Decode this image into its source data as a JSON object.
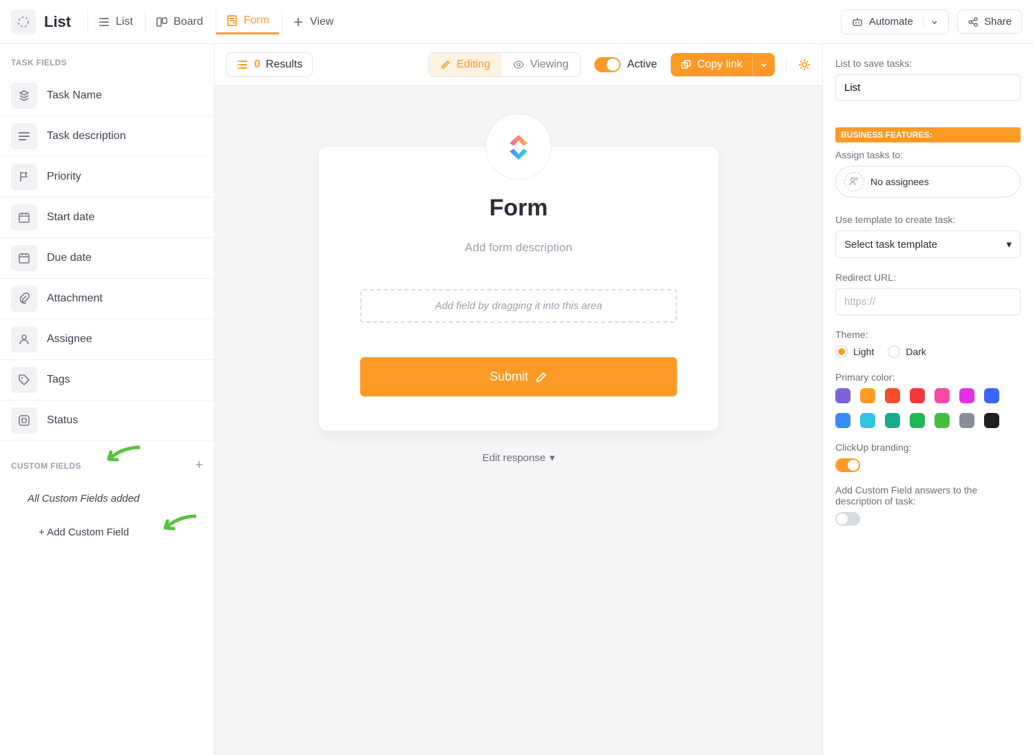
{
  "header": {
    "title": "List",
    "tabs": {
      "list": "List",
      "board": "Board",
      "form": "Form",
      "view": "View"
    },
    "automate": "Automate",
    "share": "Share"
  },
  "sidebar": {
    "task_fields_label": "TASK FIELDS",
    "fields": {
      "task_name": "Task Name",
      "task_description": "Task description",
      "priority": "Priority",
      "start_date": "Start date",
      "due_date": "Due date",
      "attachment": "Attachment",
      "assignee": "Assignee",
      "tags": "Tags",
      "status": "Status"
    },
    "custom_fields_label": "CUSTOM FIELDS",
    "all_custom_fields_msg": "All Custom Fields added",
    "add_custom_field": "+ Add Custom Field"
  },
  "toolbar": {
    "results_count": "0",
    "results_label": "Results",
    "editing": "Editing",
    "viewing": "Viewing",
    "active": "Active",
    "copy_link": "Copy link"
  },
  "form": {
    "title": "Form",
    "description_placeholder": "Add form description",
    "drop_hint": "Add field by dragging it into this area",
    "submit": "Submit",
    "edit_response": "Edit response"
  },
  "right": {
    "list_save_label": "List to save tasks:",
    "list_value": "List",
    "business_features": "BUSINESS FEATURES:",
    "assign_label": "Assign tasks to:",
    "no_assignees": "No assignees",
    "template_label": "Use template to create task:",
    "template_value": "Select task template",
    "redirect_label": "Redirect URL:",
    "redirect_placeholder": "https://",
    "theme_label": "Theme:",
    "theme_light": "Light",
    "theme_dark": "Dark",
    "primary_color_label": "Primary color:",
    "colors": [
      "#7f62db",
      "#fd9a26",
      "#f84d2c",
      "#f13a3a",
      "#f948a8",
      "#e52eea",
      "#3a66f5",
      "#3a8af5",
      "#2ec5e3",
      "#1aa98e",
      "#20b857",
      "#46bd40",
      "#8b8e97",
      "#1e1f23"
    ],
    "branding_label": "ClickUp branding:",
    "custom_field_answers_label": "Add Custom Field answers to the description of task:"
  }
}
